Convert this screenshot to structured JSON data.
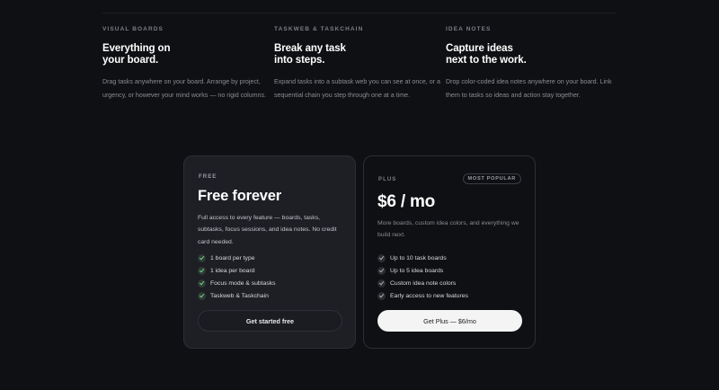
{
  "features": [
    {
      "eyebrow": "VISUAL BOARDS",
      "title": "Everything on\nyour board.",
      "description": "Drag tasks anywhere on your board. Arrange by project, urgency, or however your mind works — no rigid columns."
    },
    {
      "eyebrow": "TASKWEB & TASKCHAIN",
      "title": "Break any task\ninto steps.",
      "description": "Expand tasks into a subtask web you can see at once, or a sequential chain you step through one at a time."
    },
    {
      "eyebrow": "IDEA NOTES",
      "title": "Capture ideas\nnext to the work.",
      "description": "Drop color-coded idea notes anywhere on your board. Link them to tasks so ideas and action stay together."
    }
  ],
  "plans": {
    "free": {
      "tier": "FREE",
      "price": "Free forever",
      "blurb": "Full access to every feature — boards, tasks, subtasks, focus sessions, and idea notes. No credit card needed.",
      "items": [
        "1 board per type",
        "1 idea per board",
        "Focus mode & subtasks",
        "Taskweb & Taskchain"
      ],
      "cta": "Get started free"
    },
    "plus": {
      "tier": "PLUS",
      "badge": "MOST POPULAR",
      "price": "$6 / mo",
      "blurb": "More boards, custom idea colors, and everything we build next.",
      "items": [
        "Up to 10 task boards",
        "Up to 5 idea boards",
        "Custom idea note colors",
        "Early access to new features"
      ],
      "cta": "Get Plus — $6/mo"
    }
  },
  "colors": {
    "background": "#0f1013",
    "free_card": "#1d1f25",
    "check_free": "#6fcf8a"
  }
}
